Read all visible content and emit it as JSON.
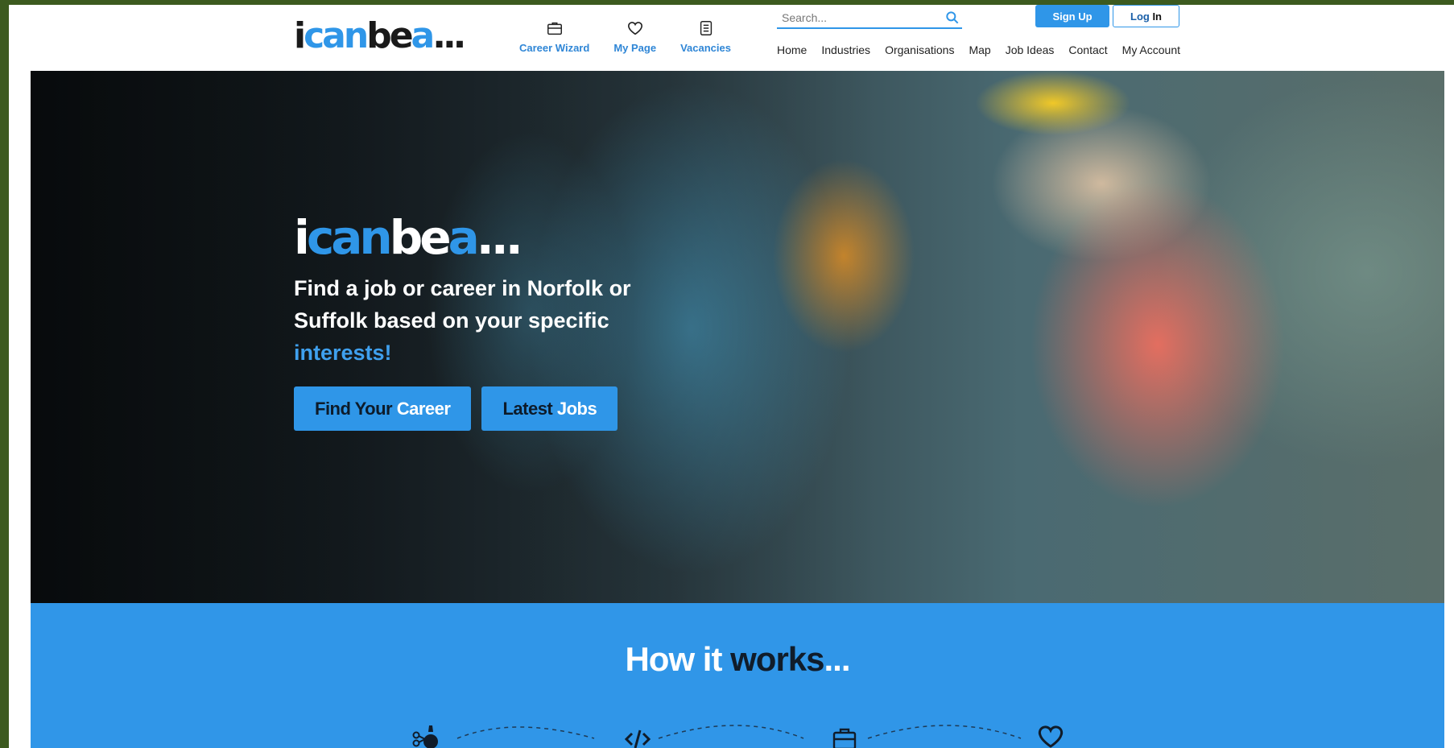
{
  "logo": {
    "part1": "i",
    "part2": "can",
    "part3": "bea",
    "dots": "..."
  },
  "quick_links": [
    {
      "label": "Career Wizard",
      "icon": "briefcase-icon"
    },
    {
      "label": "My Page",
      "icon": "heart-icon"
    },
    {
      "label": "Vacancies",
      "icon": "document-icon"
    }
  ],
  "search": {
    "placeholder": "Search...",
    "icon": "search-icon"
  },
  "auth": {
    "signup": "Sign Up",
    "login_part1": "Log ",
    "login_part2": "In"
  },
  "nav": [
    "Home",
    "Industries",
    "Organisations",
    "Map",
    "Job Ideas",
    "Contact",
    "My Account"
  ],
  "hero": {
    "logo_part1": "i",
    "logo_part2": "can",
    "logo_part3": "bea",
    "logo_dots": "...",
    "text_line": "Find a job or career in Norfolk or Suffolk based on your specific",
    "text_highlight": "interests!",
    "btn_find_dark": "Find Your ",
    "btn_find_light": "Career",
    "btn_jobs_dark": "Latest ",
    "btn_jobs_light": "Jobs"
  },
  "how": {
    "title_white": "How it ",
    "title_dark": "works",
    "title_dots": "...",
    "steps": [
      {
        "icon": "skills-tools-icon"
      },
      {
        "icon": "code-icon"
      },
      {
        "icon": "briefcase-icon"
      },
      {
        "icon": "heart-icon"
      }
    ]
  },
  "colors": {
    "brand_blue": "#2f96e8",
    "dark": "#1a1a1a",
    "frame": "#3c5a1f"
  }
}
